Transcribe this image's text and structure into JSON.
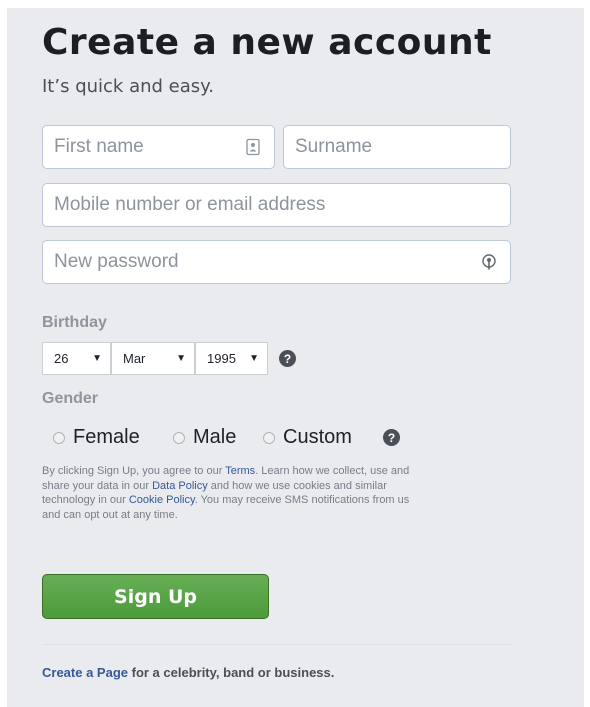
{
  "form": {
    "title": "Create a new account",
    "subtitle": "It’s quick and easy.",
    "first_name_placeholder": "First name",
    "surname_placeholder": "Surname",
    "contact_placeholder": "Mobile number or email address",
    "password_placeholder": "New password"
  },
  "birthday": {
    "label": "Birthday",
    "day": "26",
    "month": "Mar",
    "year": "1995",
    "help": "?"
  },
  "gender": {
    "label": "Gender",
    "options": [
      "Female",
      "Male",
      "Custom"
    ],
    "help": "?"
  },
  "legal": {
    "part1": "By clicking Sign Up, you agree to our ",
    "terms_link": "Terms",
    "part2": ". Learn how we collect, use and share your data in our ",
    "data_policy_link": "Data Policy",
    "part3": " and how we use cookies and similar technology in our ",
    "cookie_policy_link": "Cookie Policy",
    "part4": ". You may receive SMS notifications from us and can opt out at any time."
  },
  "signup_label": "Sign Up",
  "footer": {
    "link": "Create a Page",
    "rest": " for a celebrity, band or business."
  },
  "colors": {
    "page_bg": "#e9ebee",
    "button_green": "#4c9b3c",
    "link_blue": "#365899"
  },
  "icons": {
    "first_name_field": "contact-card-icon",
    "password_field": "password-key-icon"
  }
}
